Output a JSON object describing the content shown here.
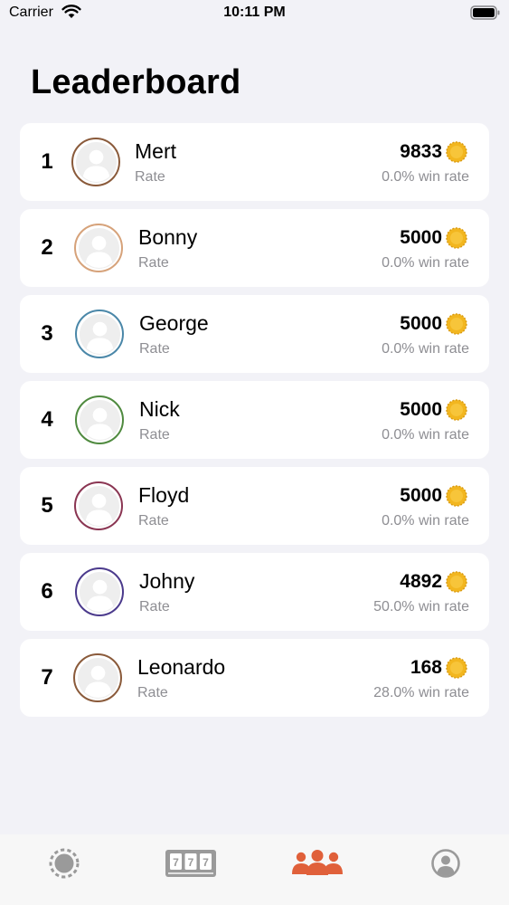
{
  "status_bar": {
    "carrier": "Carrier",
    "time": "10:11 PM"
  },
  "page": {
    "title": "Leaderboard"
  },
  "leaderboard": [
    {
      "rank": "1",
      "name": "Mert",
      "subtitle": "Rate",
      "score": "9833",
      "win_rate": "0.0% win rate",
      "ring_color": "#8a5a3a"
    },
    {
      "rank": "2",
      "name": "Bonny",
      "subtitle": "Rate",
      "score": "5000",
      "win_rate": "0.0% win rate",
      "ring_color": "#d6a27a"
    },
    {
      "rank": "3",
      "name": "George",
      "subtitle": "Rate",
      "score": "5000",
      "win_rate": "0.0% win rate",
      "ring_color": "#4a87a8"
    },
    {
      "rank": "4",
      "name": "Nick",
      "subtitle": "Rate",
      "score": "5000",
      "win_rate": "0.0% win rate",
      "ring_color": "#4f8a3f"
    },
    {
      "rank": "5",
      "name": "Floyd",
      "subtitle": "Rate",
      "score": "5000",
      "win_rate": "0.0% win rate",
      "ring_color": "#8a3552"
    },
    {
      "rank": "6",
      "name": "Johny",
      "subtitle": "Rate",
      "score": "4892",
      "win_rate": "50.0% win rate",
      "ring_color": "#4b3a8c"
    },
    {
      "rank": "7",
      "name": "Leonardo",
      "subtitle": "Rate",
      "score": "168",
      "win_rate": "28.0% win rate",
      "ring_color": "#8a5a3a"
    }
  ],
  "tab_bar": {
    "tabs": [
      {
        "icon": "poker-chip-icon",
        "active": false
      },
      {
        "icon": "slot-machine-icon",
        "active": false
      },
      {
        "icon": "group-icon",
        "active": true
      },
      {
        "icon": "profile-icon",
        "active": false
      }
    ],
    "active_color": "#e0603a",
    "inactive_color": "#9a9a9a"
  },
  "colors": {
    "coin": "#f2b61f",
    "background": "#f2f2f7"
  }
}
